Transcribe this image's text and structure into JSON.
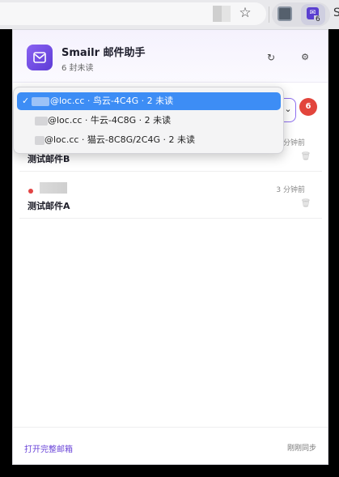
{
  "browser": {
    "bookmark_icon": "star-icon",
    "extension_badge": "6",
    "overflow_char": "S"
  },
  "popup": {
    "app_title": "Smailr 邮件助手",
    "unread_summary": "6 封未读",
    "accent_color": "#6a44d8",
    "account_select": {
      "options": [
        {
          "label": "@loc.cc · 鸟云-4C4G · 2 未读",
          "selected": true
        },
        {
          "label": "@loc.cc · 牛云-4C8G · 2 未读",
          "selected": false
        },
        {
          "label": "@loc.cc · 猫云-8C8G/2C4G · 2 未读",
          "selected": false
        }
      ],
      "check_mark": "✓"
    },
    "unread_badge": "6",
    "badge_color": "#e2453c",
    "mails": [
      {
        "time": "分钟前",
        "subject": "测试邮件B",
        "unread": false
      },
      {
        "time": "3 分钟前",
        "subject": "测试邮件A",
        "unread": true
      }
    ],
    "footer": {
      "open_label": "打开完整邮箱",
      "sync_status": "刚刚同步"
    }
  }
}
